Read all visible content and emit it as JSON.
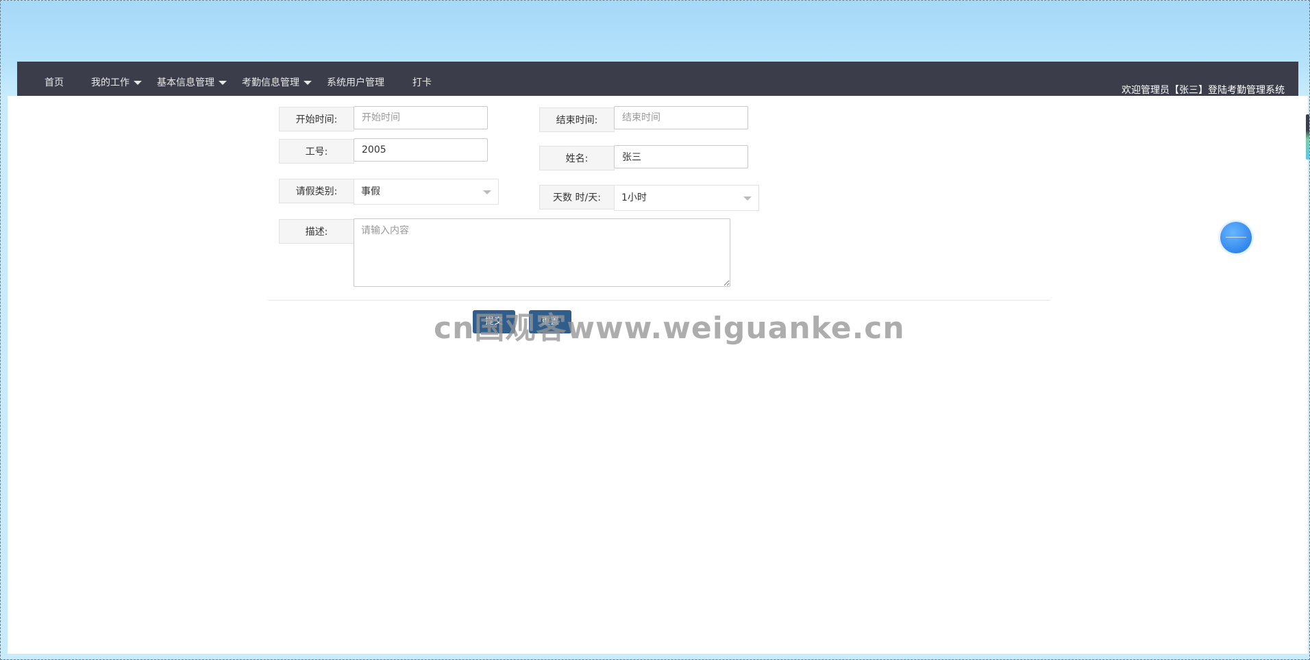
{
  "nav": {
    "items": [
      {
        "label": "首页",
        "dropdown": false
      },
      {
        "label": "我的工作",
        "dropdown": true
      },
      {
        "label": "基本信息管理",
        "dropdown": true
      },
      {
        "label": "考勤信息管理",
        "dropdown": true
      },
      {
        "label": "系统用户管理",
        "dropdown": false
      },
      {
        "label": "打卡",
        "dropdown": false
      }
    ],
    "welcome": "欢迎管理员【张三】登陆考勤管理系统"
  },
  "form": {
    "start_time": {
      "label": "开始时间:",
      "placeholder": "开始时间",
      "value": ""
    },
    "end_time": {
      "label": "结束时间:",
      "placeholder": "结束时间",
      "value": ""
    },
    "employee_id": {
      "label": "工号:",
      "value": "2005"
    },
    "name": {
      "label": "姓名:",
      "value": "张三"
    },
    "leave_type": {
      "label": "请假类别:",
      "value": "事假"
    },
    "days": {
      "label": "天数 时/天:",
      "value": "1小时"
    },
    "description": {
      "label": "描述:",
      "placeholder": "请输入内容",
      "value": ""
    }
  },
  "buttons": {
    "submit": "提交",
    "reset": "重置"
  },
  "watermark": "cn国观客www.weiguanke.cn"
}
